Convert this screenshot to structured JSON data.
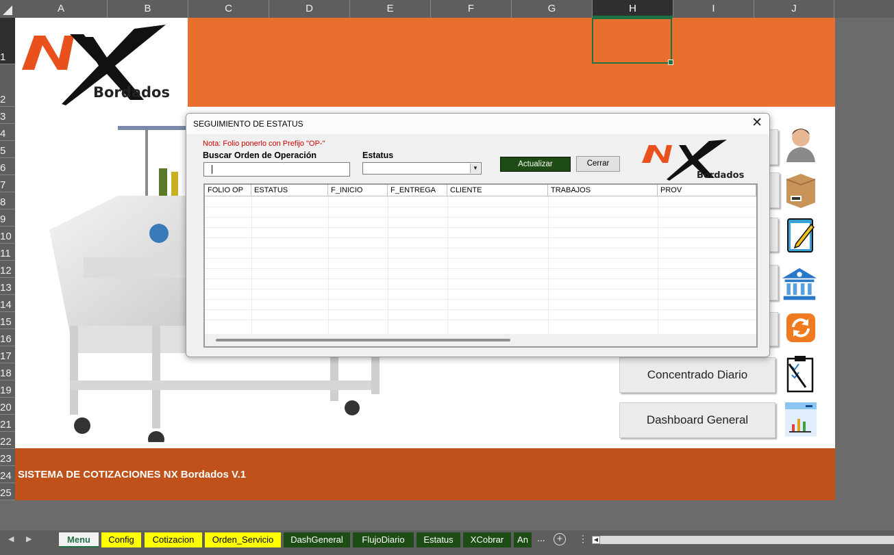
{
  "columns": [
    "A",
    "B",
    "C",
    "D",
    "E",
    "F",
    "G",
    "H",
    "I",
    "J"
  ],
  "selected_column": "H",
  "rows": [
    "1",
    "2",
    "3",
    "4",
    "5",
    "6",
    "7",
    "8",
    "9",
    "10",
    "11",
    "12",
    "13",
    "14",
    "15",
    "16",
    "17",
    "18",
    "19",
    "20",
    "21",
    "22",
    "23",
    "24",
    "25"
  ],
  "selected_row": "1",
  "logo": {
    "text": "Bordados"
  },
  "footer_title": "SISTEMA DE COTIZACIONES NX Bordados V.1",
  "menu_buttons": [
    {
      "label": "Concentrado Diario",
      "icon": "checklist-icon"
    },
    {
      "label": "Dashboard General",
      "icon": "bar-chart-icon"
    }
  ],
  "side_icons": [
    "user-icon",
    "box-icon",
    "notepad-icon",
    "bank-icon",
    "refresh-icon",
    "checklist-icon",
    "bar-chart-icon"
  ],
  "dialog": {
    "title": "SEGUIMIENTO DE ESTATUS",
    "close_glyph": "✕",
    "note": "Nota: Folio ponerlo con Prefijo \"OP-\"",
    "search_label": "Buscar Orden de Operación",
    "search_value": "",
    "status_label": "Estatus",
    "status_value": "",
    "update_button": "Actualizar",
    "close_button": "Cerrar",
    "logo_text": "Bordados",
    "grid_headers": [
      "FOLIO OP",
      "ESTATUS",
      "F_INICIO",
      "F_ENTREGA",
      "CLIENTE",
      "TRABAJOS",
      "PROV"
    ]
  },
  "sheet_tabs": [
    {
      "label": "Menu",
      "style": "active"
    },
    {
      "label": "Config",
      "style": "yellow"
    },
    {
      "label": "Cotizacion",
      "style": "yellow"
    },
    {
      "label": "Orden_Servicio",
      "style": "yellow"
    },
    {
      "label": "DashGeneral",
      "style": "green"
    },
    {
      "label": "FlujoDiario",
      "style": "green"
    },
    {
      "label": "Estatus",
      "style": "green"
    },
    {
      "label": "XCobrar",
      "style": "green"
    },
    {
      "label": "An",
      "style": "green"
    }
  ],
  "tab_more": "...",
  "colors": {
    "orange_header": "#e96f2f",
    "orange_footer": "#c0511a",
    "tab_green": "#1d4d14",
    "tab_yellow": "#ffff00",
    "excel_green": "#1e7145"
  }
}
